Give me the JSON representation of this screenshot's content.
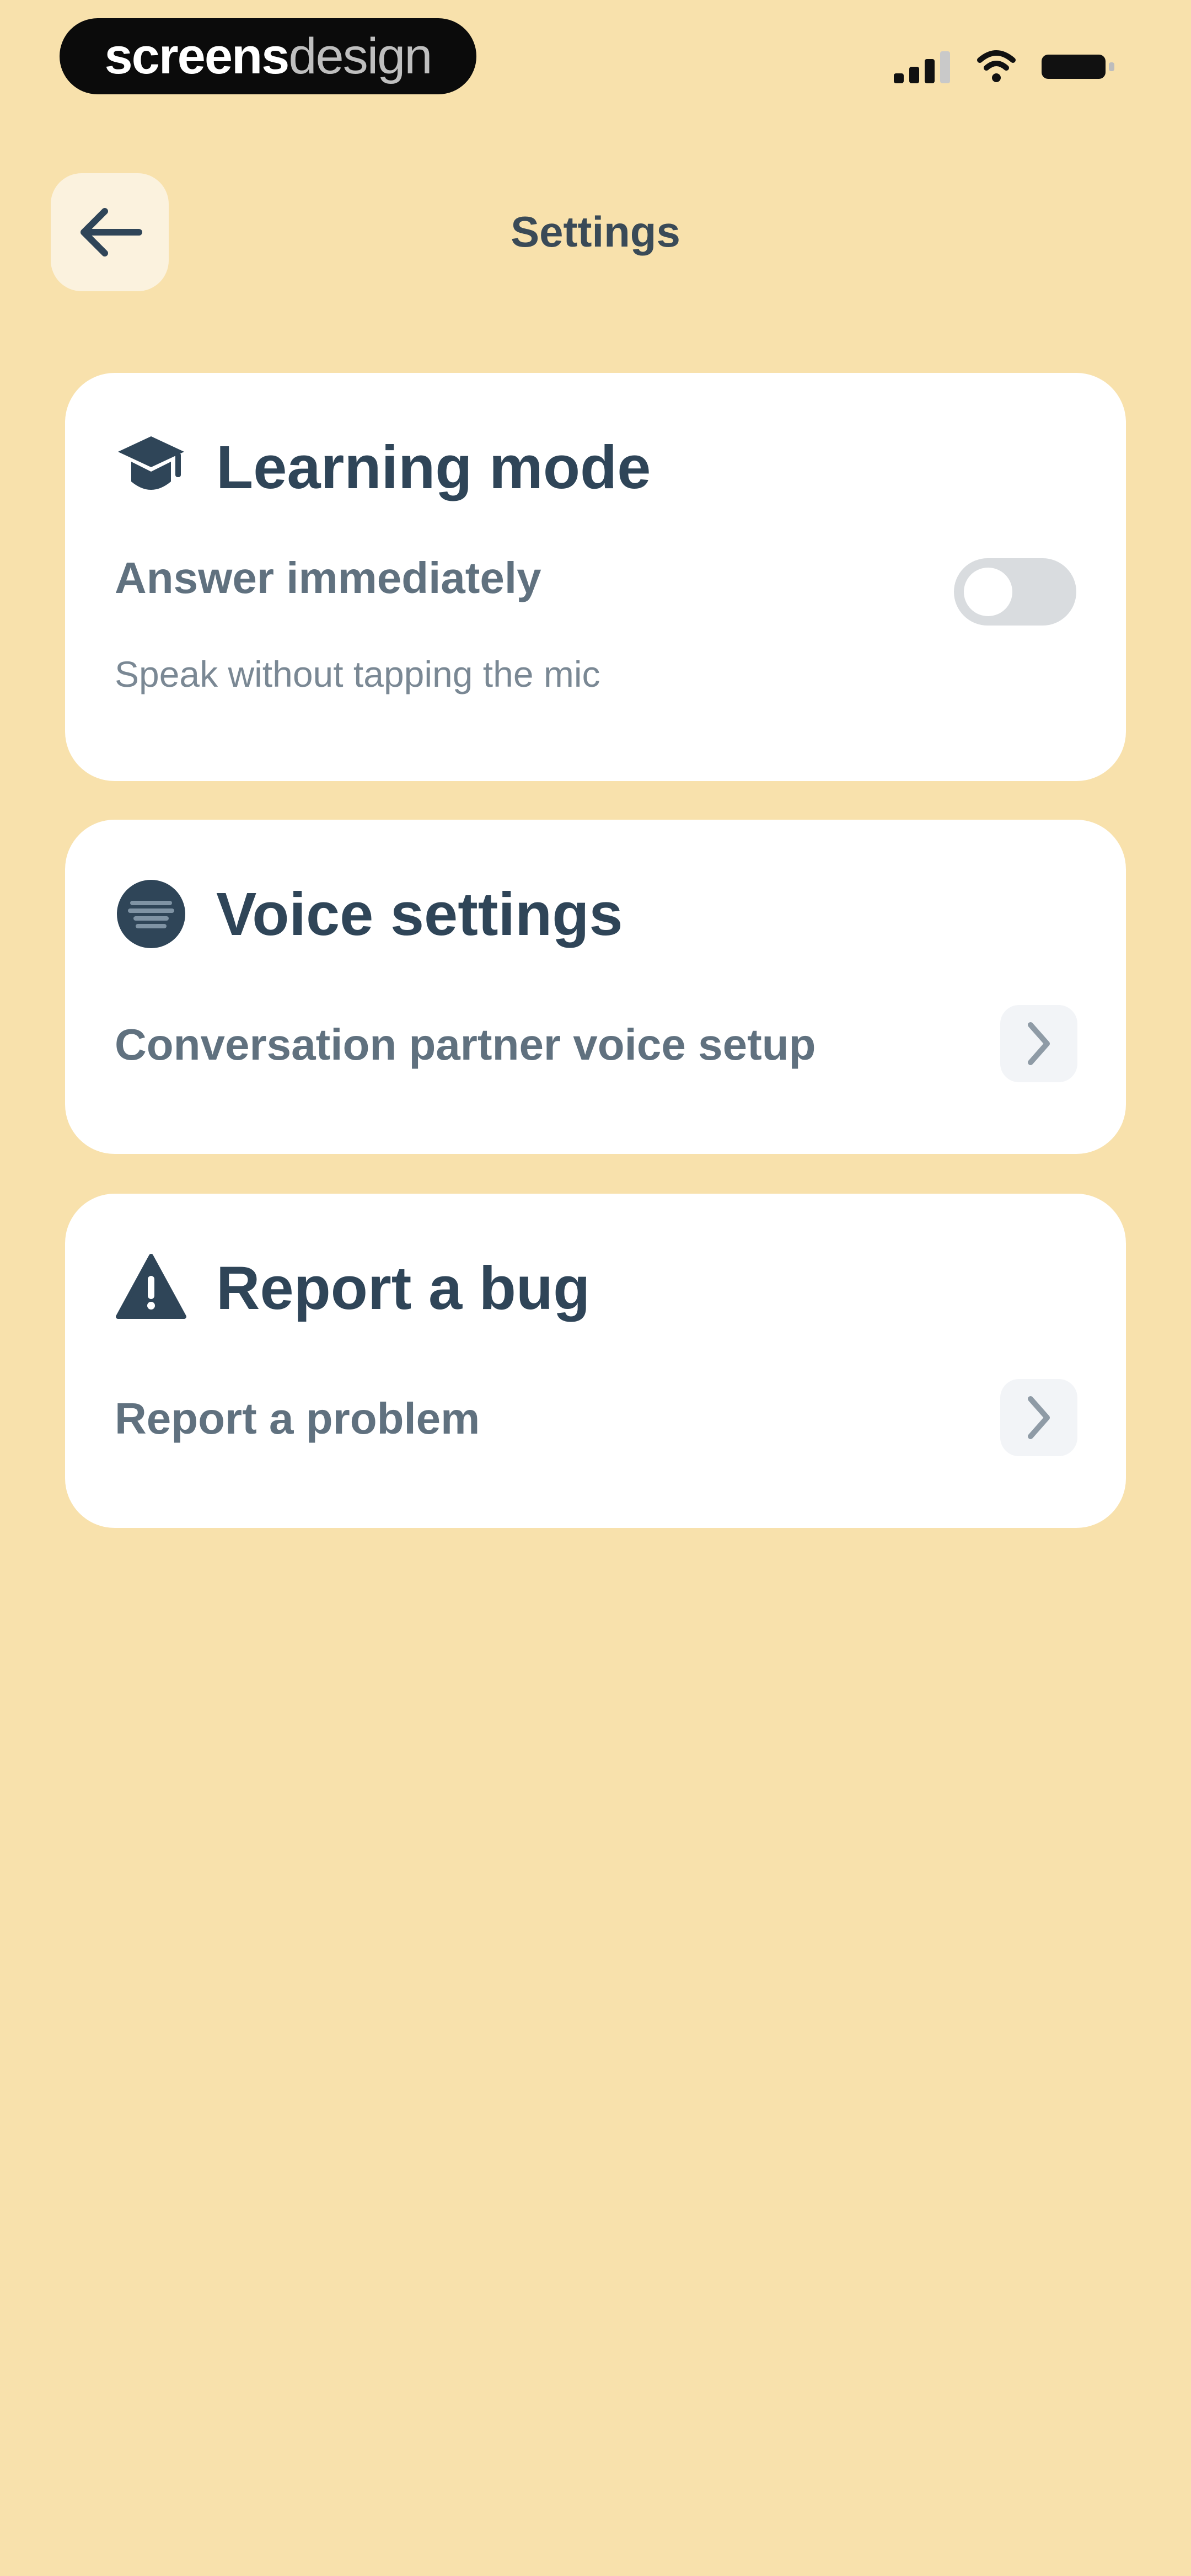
{
  "status_bar": {
    "brand_primary": "screens",
    "brand_secondary": "design"
  },
  "header": {
    "title": "Settings"
  },
  "sections": [
    {
      "title": "Learning mode",
      "icon": "graduation-cap-icon",
      "row": {
        "label": "Answer immediately",
        "subtitle": "Speak without tapping the mic",
        "toggle_on": false
      }
    },
    {
      "title": "Voice settings",
      "icon": "voice-icon",
      "row": {
        "label": "Conversation partner voice setup"
      }
    },
    {
      "title": "Report a bug",
      "icon": "warning-icon",
      "row": {
        "label": "Report a problem"
      }
    }
  ],
  "colors": {
    "background": "#f8e1ac",
    "card": "#ffffff",
    "title_text": "#2f4558",
    "secondary_text": "#60717f",
    "toggle_off": "#d9dcdf"
  }
}
